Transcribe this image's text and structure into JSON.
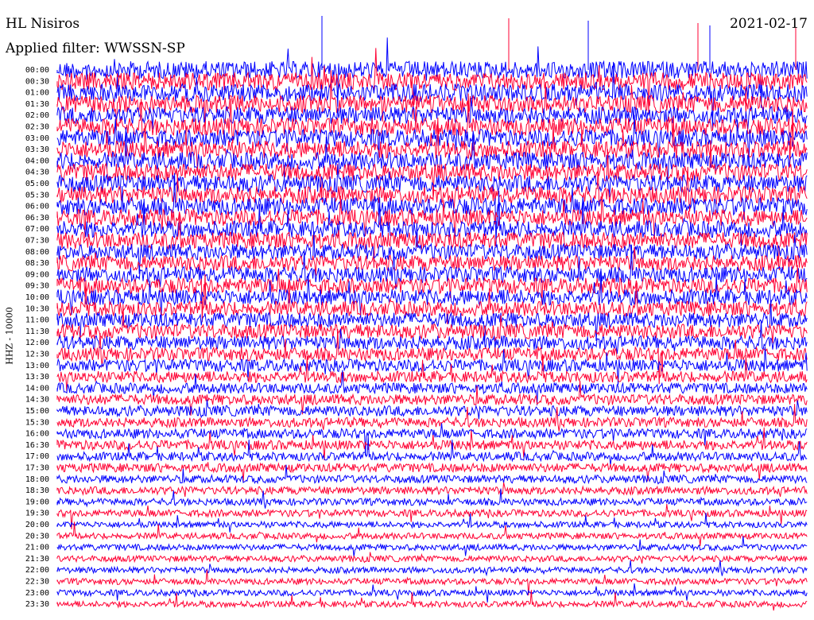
{
  "header": {
    "station": "HL Nisiros",
    "date": "2021-02-17",
    "filter": "Applied filter: WWSSN-SP"
  },
  "chart_data": {
    "type": "line",
    "title": "HL Nisiros",
    "date": "2021-02-17",
    "filter": "WWSSN-SP",
    "ylabel": "HHZ - 10000",
    "row_labels": [
      "00:00",
      "00:30",
      "01:00",
      "01:30",
      "02:00",
      "02:30",
      "03:00",
      "03:30",
      "04:00",
      "04:30",
      "05:00",
      "05:30",
      "06:00",
      "06:30",
      "07:00",
      "07:30",
      "08:00",
      "08:30",
      "09:00",
      "09:30",
      "10:00",
      "10:30",
      "11:00",
      "11:30",
      "12:00",
      "12:30",
      "13:00",
      "13:30",
      "14:00",
      "14:30",
      "15:00",
      "15:30",
      "16:00",
      "16:30",
      "17:00",
      "17:30",
      "18:00",
      "18:30",
      "19:00",
      "19:30",
      "20:00",
      "20:30",
      "21:00",
      "21:30",
      "22:00",
      "22:30",
      "23:00",
      "23:30"
    ],
    "series_colors": [
      "#0000ff",
      "#ff0033"
    ],
    "amplitude_profile": [
      1.0,
      1.0,
      1.0,
      1.0,
      1.0,
      1.0,
      1.0,
      1.0,
      1.0,
      1.0,
      1.0,
      1.0,
      1.0,
      0.95,
      0.95,
      0.95,
      0.9,
      0.9,
      0.9,
      0.9,
      0.9,
      0.85,
      0.85,
      0.85,
      0.8,
      0.75,
      0.7,
      0.65,
      0.6,
      0.6,
      0.6,
      0.55,
      0.55,
      0.55,
      0.5,
      0.5,
      0.45,
      0.45,
      0.4,
      0.4,
      0.35,
      0.35,
      0.35,
      0.35,
      0.35,
      0.35,
      0.35,
      0.35
    ]
  }
}
